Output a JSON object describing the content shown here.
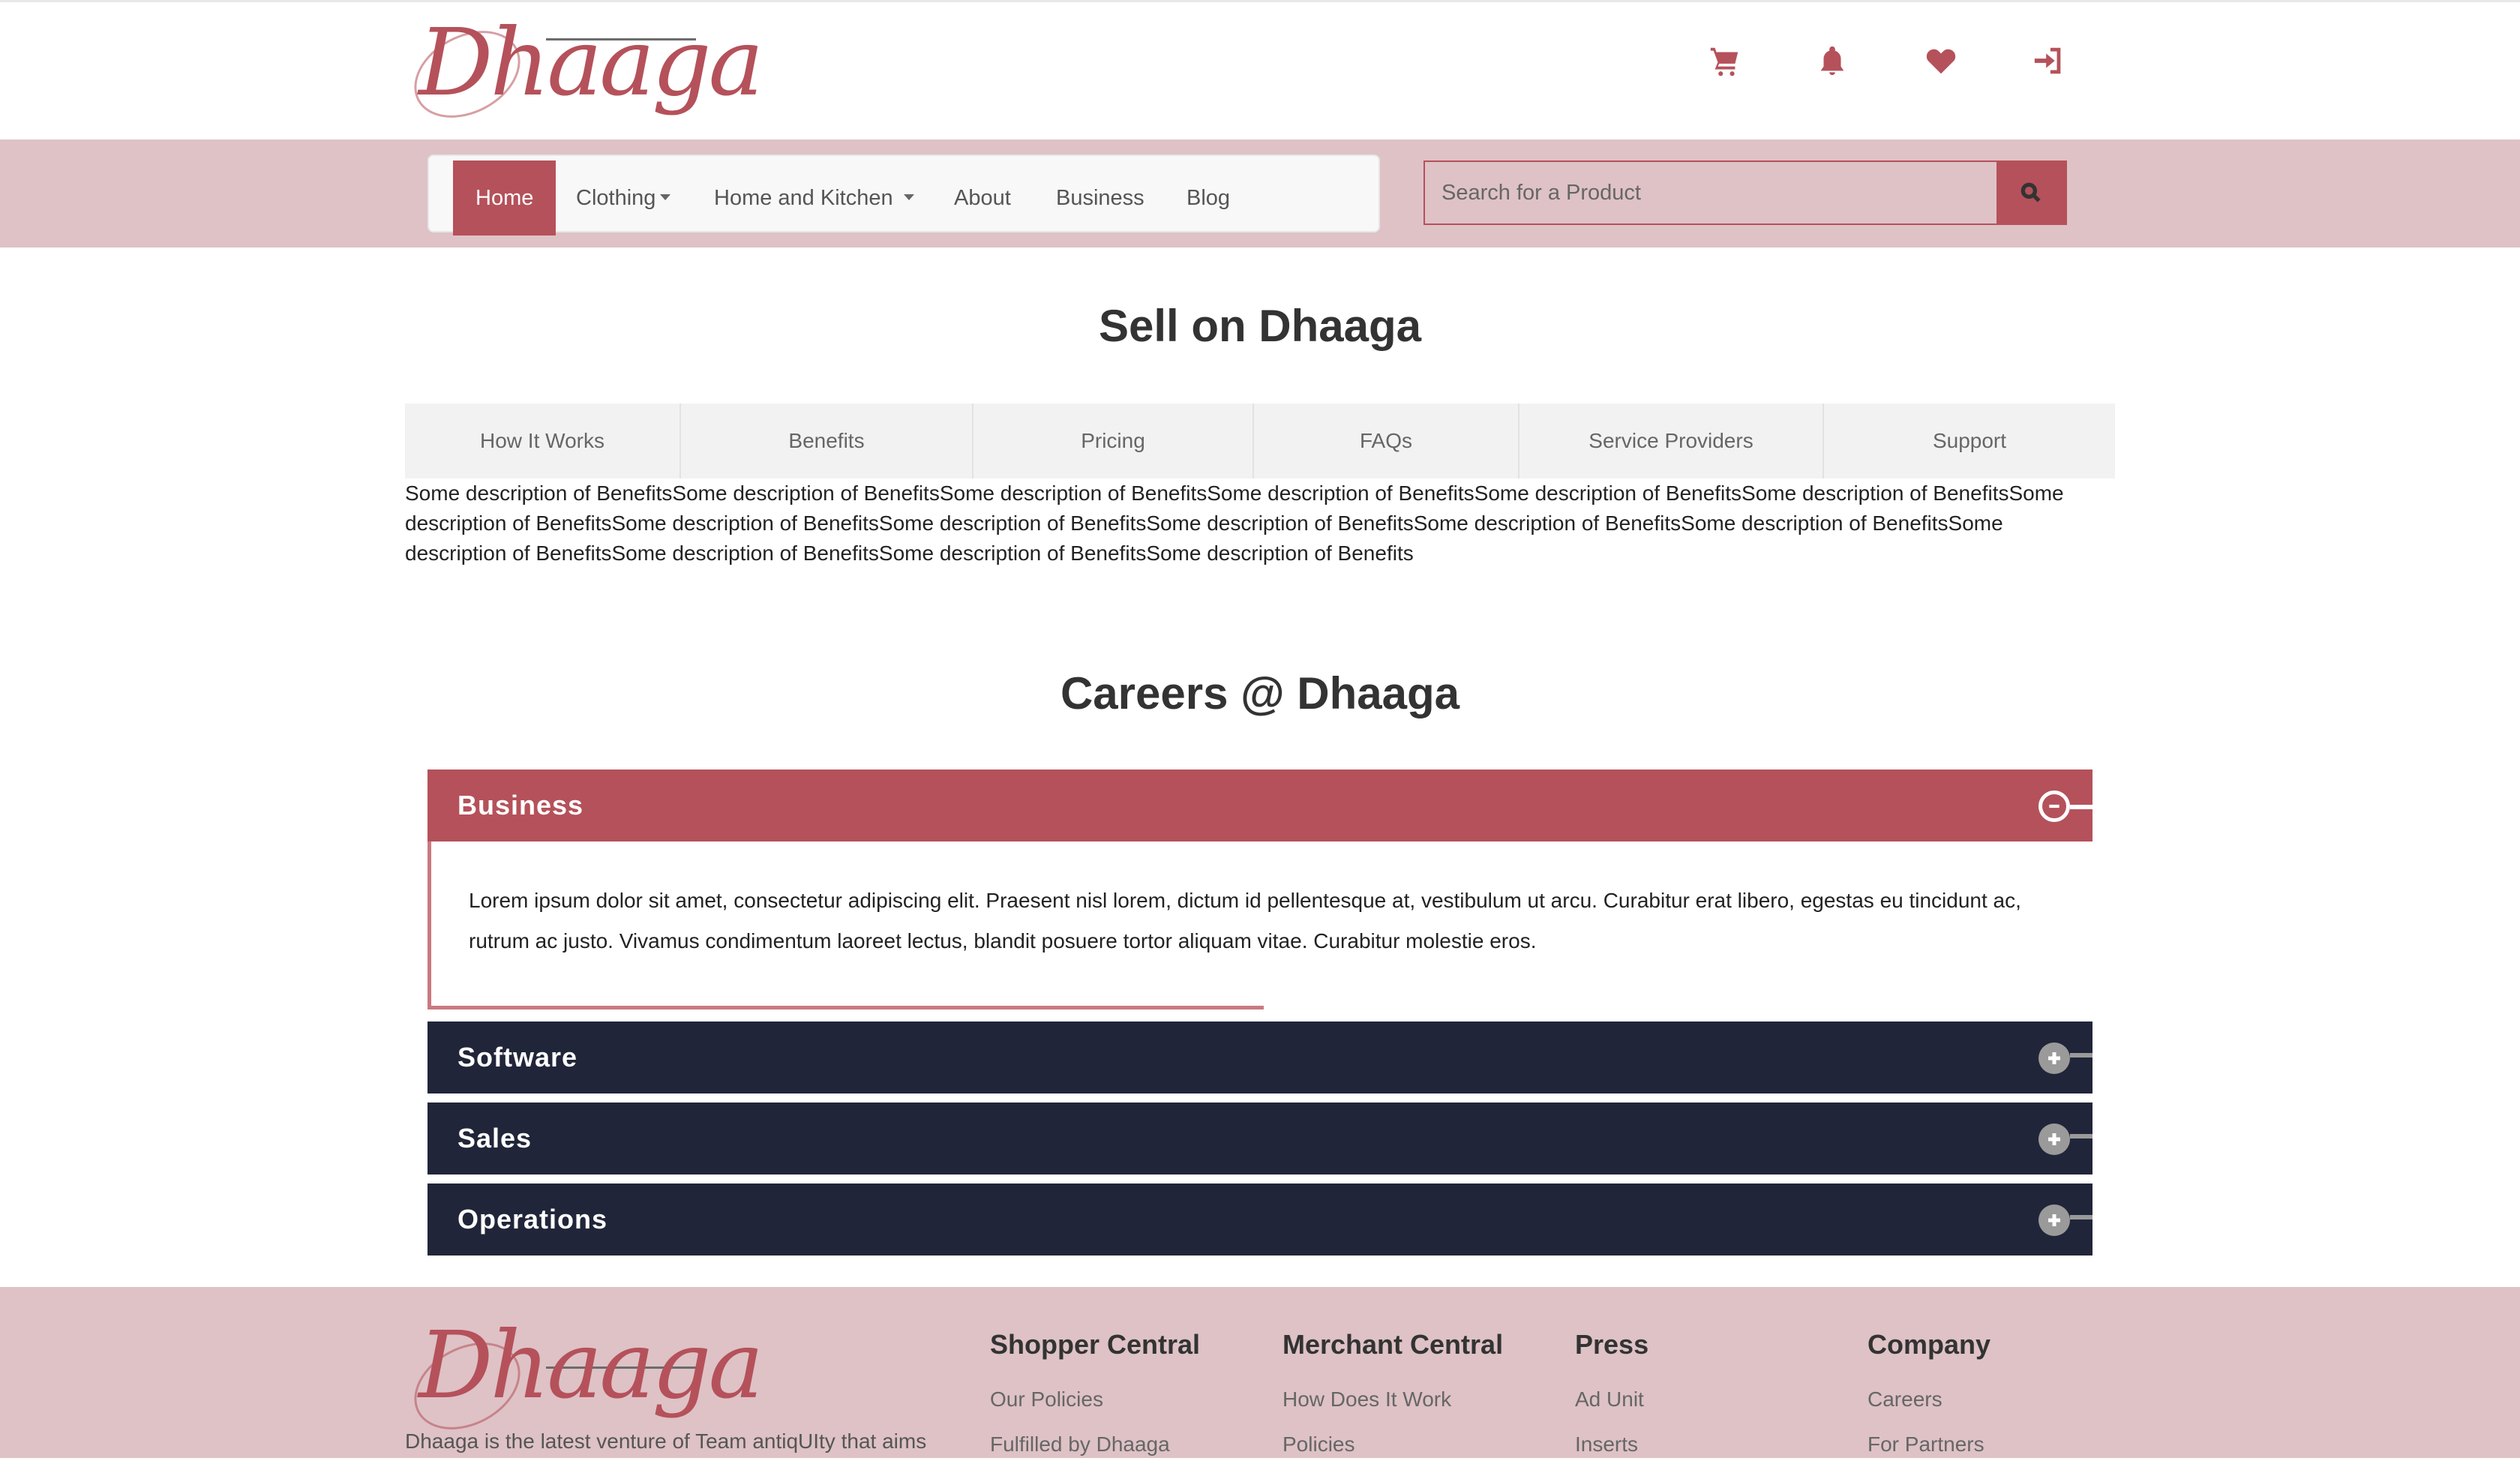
{
  "brand": {
    "name": "Dhaaga",
    "accent": "#b5515a",
    "nav_band": "#dec2c6",
    "dark": "#212539"
  },
  "header": {
    "icons": [
      {
        "name": "cart-icon"
      },
      {
        "name": "bell-icon"
      },
      {
        "name": "heart-icon"
      },
      {
        "name": "sign-in-icon"
      }
    ]
  },
  "nav": {
    "home": "Home",
    "clothing": "Clothing",
    "home_kitchen": "Home and Kitchen",
    "about": "About",
    "business": "Business",
    "blog": "Blog",
    "search_placeholder": "Search for a Product",
    "search_icon": "search-icon"
  },
  "sell": {
    "title": "Sell on Dhaaga",
    "tabs": [
      "How It Works",
      "Benefits",
      "Pricing",
      "FAQs",
      "Service Providers",
      "Support"
    ],
    "description": "Some description of BenefitsSome description of BenefitsSome description of BenefitsSome description of BenefitsSome description of BenefitsSome description of BenefitsSome description of BenefitsSome description of BenefitsSome description of BenefitsSome description of BenefitsSome description of BenefitsSome description of BenefitsSome description of BenefitsSome description of BenefitsSome description of BenefitsSome description of Benefits"
  },
  "careers": {
    "title": "Careers @ Dhaaga",
    "sections": [
      {
        "label": "Business",
        "state": "expanded",
        "body": "Lorem ipsum dolor sit amet, consectetur adipiscing elit. Praesent nisl lorem, dictum id pellentesque at, vestibulum ut arcu. Curabitur erat libero, egestas eu tincidunt ac, rutrum ac justo. Vivamus condimentum laoreet lectus, blandit posuere tortor aliquam vitae. Curabitur molestie eros."
      },
      {
        "label": "Software",
        "state": "collapsed"
      },
      {
        "label": "Sales",
        "state": "collapsed"
      },
      {
        "label": "Operations",
        "state": "collapsed"
      }
    ]
  },
  "footer": {
    "about": "Dhaaga is the latest venture of Team antiqUIty that aims",
    "columns": [
      {
        "heading": "Shopper Central",
        "links": [
          "Our Policies",
          "Fulfilled by Dhaaga"
        ]
      },
      {
        "heading": "Merchant Central",
        "links": [
          "How Does It Work",
          "Policies"
        ]
      },
      {
        "heading": "Press",
        "links": [
          "Ad Unit",
          "Inserts"
        ]
      },
      {
        "heading": "Company",
        "links": [
          "Careers",
          "For Partners"
        ]
      }
    ]
  }
}
